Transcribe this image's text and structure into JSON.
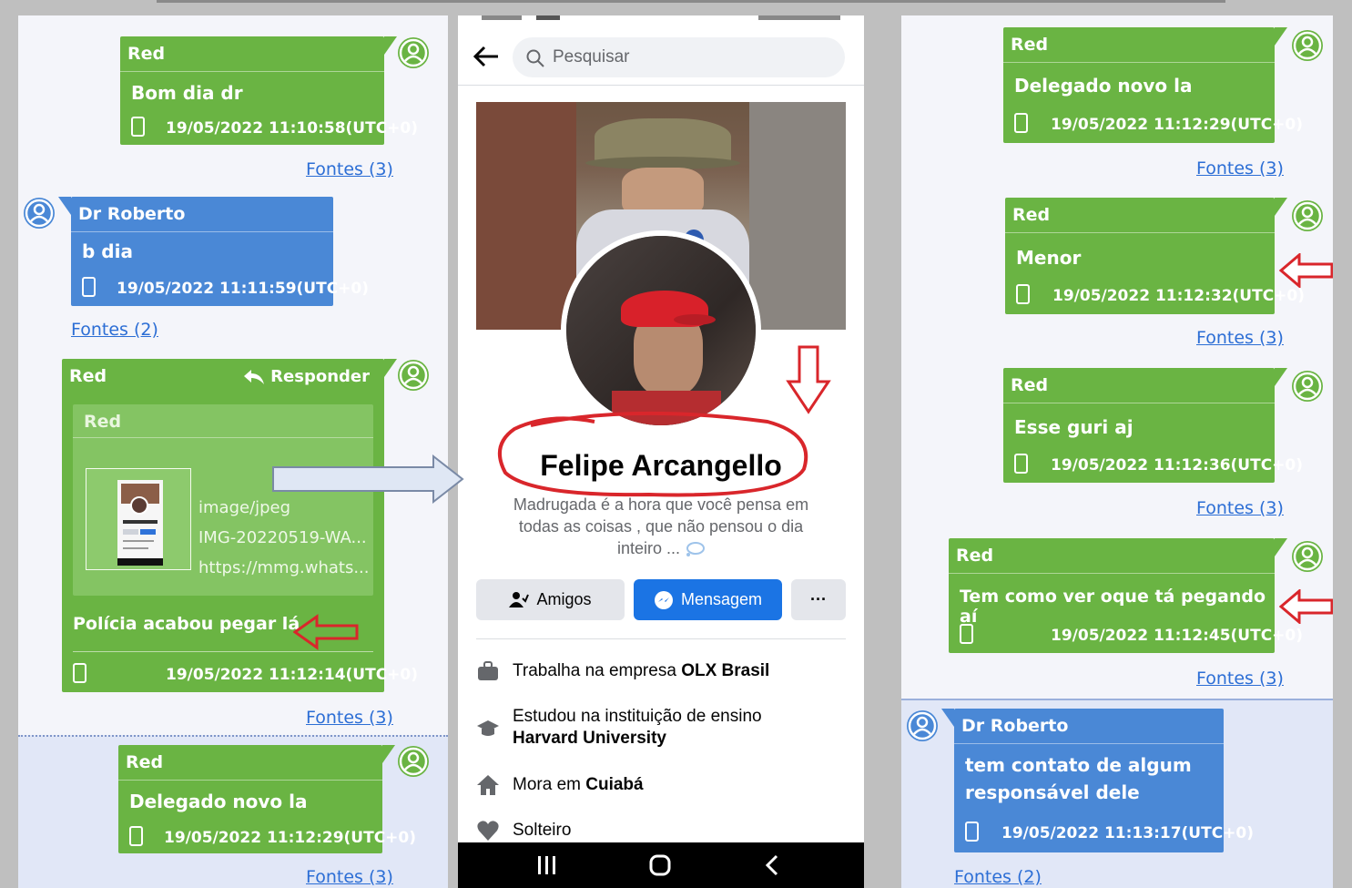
{
  "left_column": {
    "messages": [
      {
        "sender": "Red",
        "text": "Bom dia dr",
        "timestamp": "19/05/2022 11:10:58(UTC+0)",
        "sources": "Fontes (3)"
      },
      {
        "sender": "Dr Roberto",
        "text": "b dia",
        "timestamp": "19/05/2022 11:11:59(UTC+0)",
        "sources": "Fontes (2)"
      },
      {
        "sender": "Red",
        "reply_label": "Responder",
        "quoted": {
          "sender": "Red",
          "mime": "image/jpeg",
          "filename": "IMG-20220519-WA...",
          "url": "https://mmg.whats..."
        },
        "text": "Polícia acabou pegar lá",
        "timestamp": "19/05/2022 11:12:14(UTC+0)",
        "sources": "Fontes (3)"
      },
      {
        "sender": "Red",
        "text": "Delegado novo la",
        "timestamp": "19/05/2022 11:12:29(UTC+0)",
        "sources": "Fontes (3)"
      }
    ]
  },
  "phone": {
    "search_placeholder": "Pesquisar",
    "profile_name": "Felipe Arcangello",
    "bio": "Madrugada é a hora que você pensa em todas as coisas , que não pensou o dia inteiro ...",
    "buttons": {
      "friends": "Amigos",
      "message": "Mensagem",
      "more": "···"
    },
    "info": [
      {
        "icon": "briefcase-icon",
        "prefix": "Trabalha na empresa ",
        "bold": "OLX Brasil"
      },
      {
        "icon": "graduation-cap-icon",
        "prefix": "Estudou na instituição de ensino ",
        "bold": "Harvard University"
      },
      {
        "icon": "home-icon",
        "prefix": "Mora em ",
        "bold": "Cuiabá"
      },
      {
        "icon": "heart-icon",
        "prefix": "Solteiro",
        "bold": ""
      }
    ],
    "nav": [
      "recents-icon",
      "home-circle-icon",
      "back-chevron-icon"
    ]
  },
  "right_column": {
    "messages": [
      {
        "sender": "Red",
        "text": "Delegado novo la",
        "timestamp": "19/05/2022 11:12:29(UTC+0)",
        "sources": "Fontes (3)"
      },
      {
        "sender": "Red",
        "text": "Menor",
        "timestamp": "19/05/2022 11:12:32(UTC+0)",
        "sources": "Fontes (3)"
      },
      {
        "sender": "Red",
        "text": "Esse guri aj",
        "timestamp": "19/05/2022 11:12:36(UTC+0)",
        "sources": "Fontes (3)"
      },
      {
        "sender": "Red",
        "text": "Tem como ver oque tá pegando aí",
        "timestamp": "19/05/2022 11:12:45(UTC+0)",
        "sources": "Fontes (3)"
      },
      {
        "sender": "Dr Roberto",
        "text_line1": "tem contato de algum",
        "text_line2": "responsável dele",
        "timestamp": "19/05/2022 11:13:17(UTC+0)",
        "sources": "Fontes (2)"
      }
    ]
  },
  "colors": {
    "green_bubble": "#6ab443",
    "blue_bubble": "#4a88d6",
    "link": "#2c6ed5",
    "fb_blue": "#1b74e4",
    "annotation_red": "#d9262b"
  }
}
